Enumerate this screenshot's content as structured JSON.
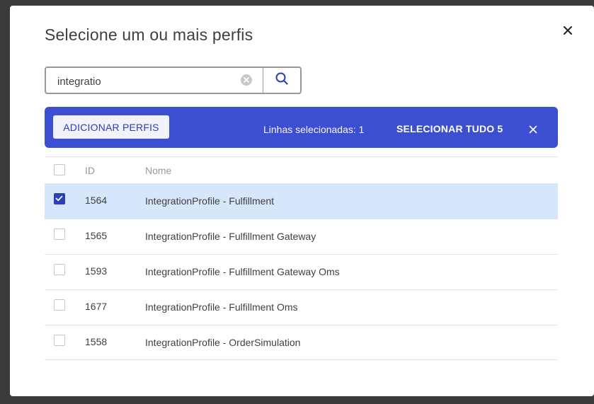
{
  "modal": {
    "title": "Selecione um ou mais perfis"
  },
  "search": {
    "value": "integratio",
    "placeholder": ""
  },
  "bulk_bar": {
    "add_label": "ADICIONAR PERFIS",
    "selected_count": "Linhas selecionadas: 1",
    "select_all_label": "SELECIONAR TUDO 5"
  },
  "table": {
    "columns": [
      "ID",
      "Nome"
    ],
    "rows": [
      {
        "id": "1564",
        "name": "IntegrationProfile - Fulfillment",
        "checked": true
      },
      {
        "id": "1565",
        "name": "IntegrationProfile - Fulfillment Gateway",
        "checked": false
      },
      {
        "id": "1593",
        "name": "IntegrationProfile - Fulfillment Gateway Oms",
        "checked": false
      },
      {
        "id": "1677",
        "name": "IntegrationProfile - Fulfillment Oms",
        "checked": false
      },
      {
        "id": "1558",
        "name": "IntegrationProfile - OrderSimulation",
        "checked": false
      }
    ]
  },
  "colors": {
    "accent": "#3c4fd0",
    "selected_row": "#d6e6fb",
    "text": "#3f3f40"
  },
  "icons": {
    "close": "close-icon",
    "clear": "clear-circle-icon",
    "search": "search-icon",
    "check": "checkmark-icon"
  }
}
